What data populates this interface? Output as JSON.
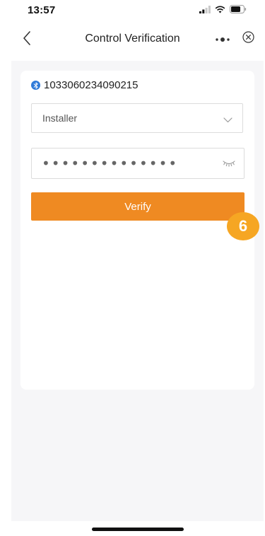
{
  "status_bar": {
    "time": "13:57"
  },
  "nav": {
    "title": "Control Verification"
  },
  "device": {
    "id": "1033060234090215"
  },
  "form": {
    "role_value": "Installer",
    "password_value": "••••••••••••••",
    "verify_label": "Verify"
  },
  "badge": {
    "number": "6"
  },
  "colors": {
    "accent": "#ef8a22",
    "badge": "#f6a623",
    "bluetooth": "#2f7ad8"
  }
}
